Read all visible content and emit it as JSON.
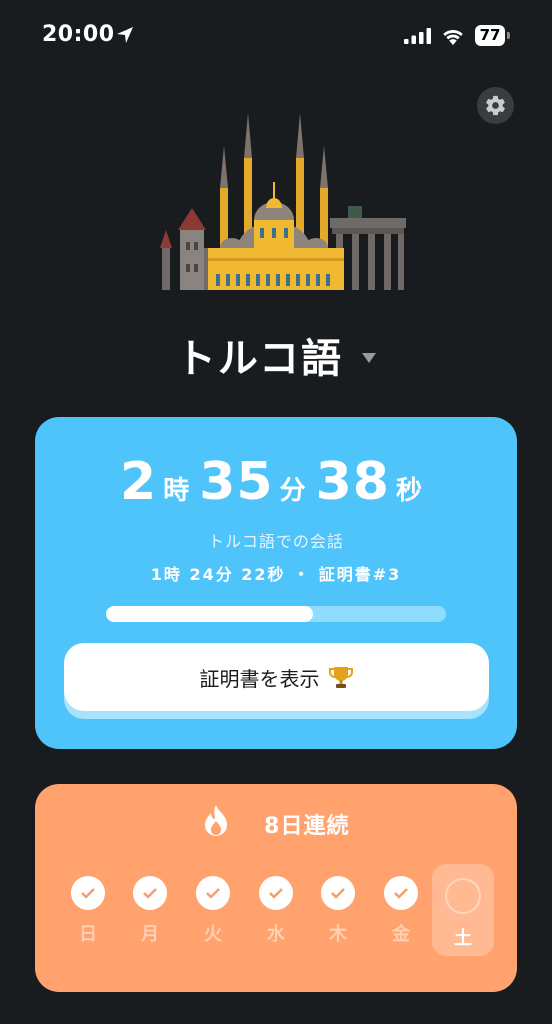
{
  "status_bar": {
    "time": "20:00",
    "battery": "77"
  },
  "language": {
    "name": "トルコ語"
  },
  "timer": {
    "hours": "2",
    "hours_unit": "時",
    "minutes": "35",
    "minutes_unit": "分",
    "seconds": "38",
    "seconds_unit": "秒",
    "caption": "トルコ語での会話",
    "remaining": "1時 24分 22秒 ・ 証明書#3",
    "progress": 0.61
  },
  "certificate_button": {
    "label": "証明書を表示"
  },
  "streak": {
    "label": "8日連続",
    "days": [
      "日",
      "月",
      "火",
      "水",
      "木",
      "金"
    ],
    "today": "土"
  },
  "colors": {
    "background": "#191c1f",
    "timer_card": "#4fc4fb",
    "streak_card": "#ffa26e"
  }
}
